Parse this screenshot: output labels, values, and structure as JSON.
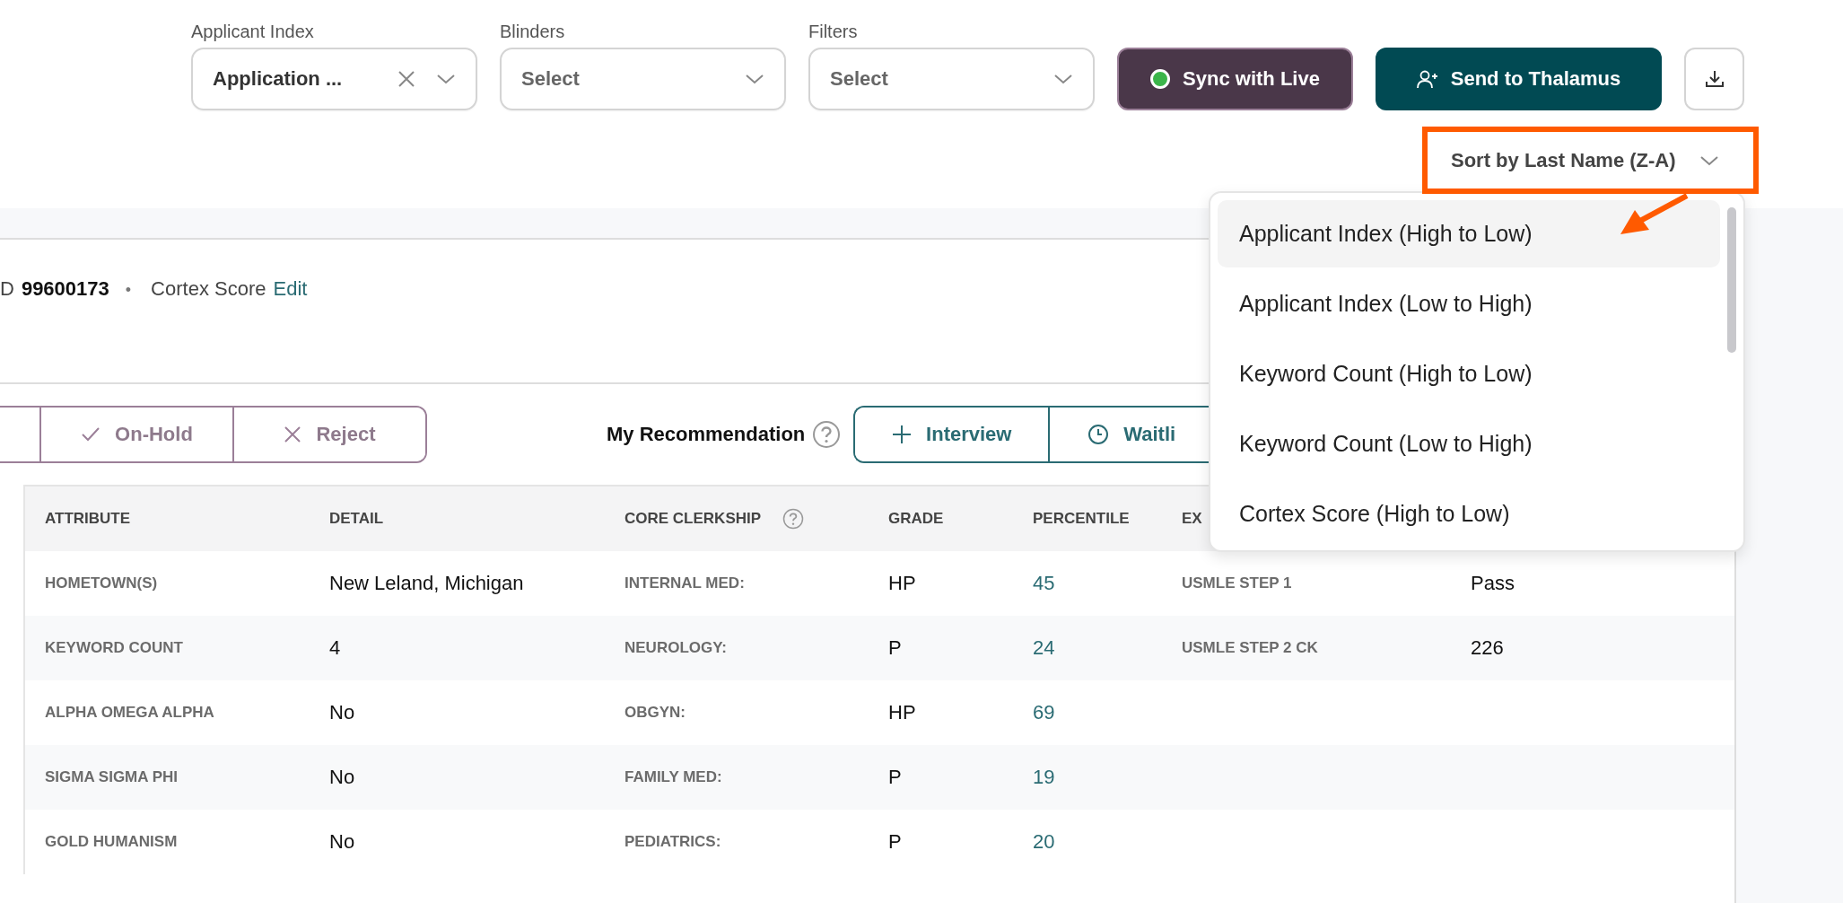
{
  "filters": [
    {
      "label": "Applicant Index",
      "value": "Application ...",
      "clearable": true
    },
    {
      "label": "Blinders",
      "placeholder": "Select"
    },
    {
      "label": "Filters",
      "placeholder": "Select"
    }
  ],
  "actions": [
    {
      "kind": "sync",
      "label": "Sync with Live",
      "live": true
    },
    {
      "kind": "send",
      "label": "Send to Thalamus"
    },
    {
      "kind": "download"
    }
  ],
  "sort": {
    "label": "Sort by Last Name (Z-A)",
    "expanded": true,
    "options": [
      {
        "label": "Applicant Index (High to Low)",
        "highlighted": true
      },
      {
        "label": "Applicant Index (Low to High)",
        "highlighted": false
      },
      {
        "label": "Keyword Count (High to Low)",
        "highlighted": false
      },
      {
        "label": "Keyword Count (Low to High)",
        "highlighted": false
      },
      {
        "label": "Cortex Score (High to Low)",
        "highlighted": false
      }
    ]
  },
  "record": {
    "id_label": "D",
    "id": "99600173",
    "separator": "•",
    "score_label": "Cortex Score",
    "edit_link": "Edit"
  },
  "decisions": [
    {
      "kind": "check",
      "label": "On-Hold"
    },
    {
      "kind": "cross",
      "label": "Reject"
    }
  ],
  "recommendation": {
    "label": "My Recommendation",
    "options": [
      {
        "kind": "plus",
        "label": "Interview"
      },
      {
        "kind": "clock",
        "label": "Waitli"
      }
    ]
  },
  "table": {
    "columns": [
      {
        "label": "ATTRIBUTE"
      },
      {
        "label": "DETAIL"
      },
      {
        "label": "CORE CLERKSHIP",
        "help": true
      },
      {
        "label": "GRADE"
      },
      {
        "label": "PERCENTILE"
      },
      {
        "label": "EX"
      }
    ],
    "rows": [
      {
        "attribute": "HOMETOWN(S)",
        "detail": "New Leland, Michigan",
        "clerkship": "INTERNAL MED:",
        "grade": "HP",
        "percentile": "45",
        "exam": "USMLE STEP 1",
        "exam_result": "Pass"
      },
      {
        "attribute": "KEYWORD COUNT",
        "detail": "4",
        "clerkship": "NEUROLOGY:",
        "grade": "P",
        "percentile": "24",
        "exam": "USMLE STEP 2 CK",
        "exam_result": "226"
      },
      {
        "attribute": "ALPHA OMEGA ALPHA",
        "detail": "No",
        "clerkship": "OBGYN:",
        "grade": "HP",
        "percentile": "69"
      },
      {
        "attribute": "SIGMA SIGMA PHI",
        "detail": "No",
        "clerkship": "FAMILY MED:",
        "grade": "P",
        "percentile": "19"
      },
      {
        "attribute": "GOLD HUMANISM",
        "detail": "No",
        "clerkship": "PEDIATRICS:",
        "grade": "P",
        "percentile": "20"
      }
    ]
  }
}
